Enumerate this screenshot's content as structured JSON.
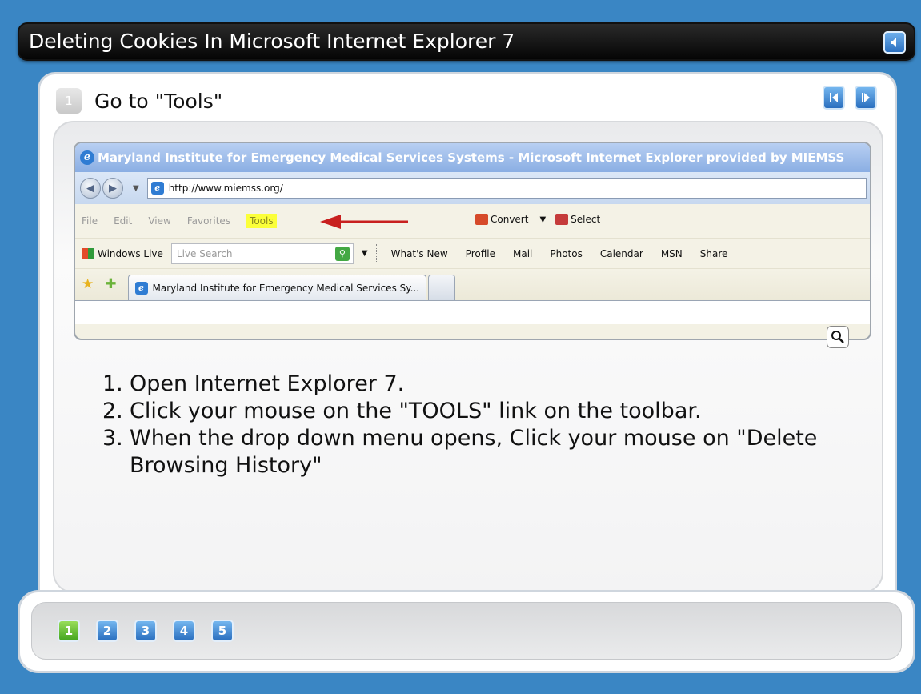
{
  "header": {
    "title": "Deleting Cookies In Microsoft Internet Explorer 7",
    "sound_icon": "speaker-icon"
  },
  "step": {
    "number": "1",
    "title": "Go to \"Tools\""
  },
  "nav": {
    "prev_icon": "previous-icon",
    "next_icon": "next-icon"
  },
  "browser": {
    "window_title": "Maryland Institute for Emergency Medical Services Systems - Microsoft Internet Explorer provided by MIEMSS",
    "address": "http://www.miemss.org/",
    "menu": [
      "File",
      "Edit",
      "View",
      "Favorites",
      "Tools"
    ],
    "convert_label": "Convert",
    "select_label": "Select",
    "windows_live_label": "Windows Live",
    "search_placeholder": "Live Search",
    "links": [
      "What's New",
      "Profile",
      "Mail",
      "Photos",
      "Calendar",
      "MSN",
      "Share"
    ],
    "tab_title": "Maryland Institute for Emergency Medical Services Sy..."
  },
  "instructions": [
    {
      "num": "1.",
      "text": "Open Internet Explorer 7."
    },
    {
      "num": "2.",
      "text": "Click your mouse on the \"TOOLS\" link on the toolbar."
    },
    {
      "num": "3.",
      "text": "When the drop down menu opens, Click your mouse on \"Delete Browsing History\""
    }
  ],
  "pagination": {
    "pages": [
      "1",
      "2",
      "3",
      "4",
      "5"
    ],
    "active": "1"
  },
  "colors": {
    "background": "#3a86c4",
    "highlight": "#fbff3a",
    "arrow": "#c8201f",
    "active_page": "#45a521"
  }
}
